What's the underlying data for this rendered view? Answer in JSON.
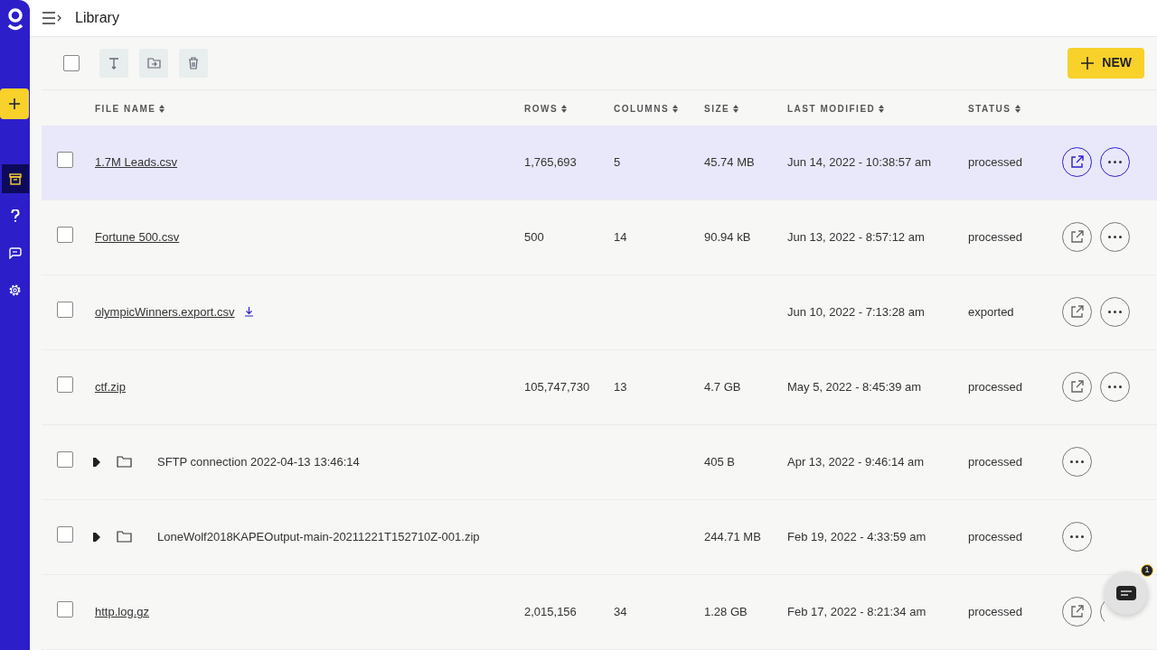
{
  "header": {
    "title": "Library"
  },
  "toolbar": {
    "select_all_checked": false,
    "new_button": "NEW"
  },
  "table": {
    "columns": [
      "FILE NAME",
      "ROWS",
      "COLUMNS",
      "SIZE",
      "LAST MODIFIED",
      "STATUS"
    ],
    "rows": [
      {
        "kind": "file",
        "checked": false,
        "name": "1.7M Leads.csv",
        "rows": "1,765,693",
        "columns": "5",
        "size": "45.74 MB",
        "modified": "Jun 14, 2022 - 10:38:57 am",
        "status": "processed",
        "highlighted": true,
        "downloadable": false
      },
      {
        "kind": "file",
        "checked": false,
        "name": "Fortune 500.csv",
        "rows": "500",
        "columns": "14",
        "size": "90.94 kB",
        "modified": "Jun 13, 2022 - 8:57:12 am",
        "status": "processed",
        "highlighted": false,
        "downloadable": false
      },
      {
        "kind": "file",
        "checked": false,
        "name": "olympicWinners.export.csv",
        "modified": "Jun 10, 2022 - 7:13:28 am",
        "status": "exported",
        "highlighted": false,
        "downloadable": true
      },
      {
        "kind": "file",
        "checked": false,
        "name": "ctf.zip",
        "rows": "105,747,730",
        "columns": "13",
        "size": "4.7 GB",
        "modified": "May 5, 2022 - 8:45:39 am",
        "status": "processed",
        "highlighted": false,
        "downloadable": false
      },
      {
        "kind": "folder",
        "checked": false,
        "name": "SFTP connection 2022-04-13 13:46:14",
        "size": "405 B",
        "modified": "Apr 13, 2022 - 9:46:14 am",
        "status": "processed",
        "highlighted": false
      },
      {
        "kind": "folder",
        "checked": false,
        "name": "LoneWolf2018KAPEOutput-main-20211221T152710Z-001.zip",
        "size": "244.71 MB",
        "modified": "Feb 19, 2022 - 4:33:59 am",
        "status": "processed",
        "highlighted": false
      },
      {
        "kind": "file",
        "checked": false,
        "name": "http.log.gz",
        "rows": "2,015,156",
        "columns": "34",
        "size": "1.28 GB",
        "modified": "Feb 17, 2022 - 8:21:34 am",
        "status": "processed",
        "highlighted": false,
        "downloadable": false
      }
    ]
  },
  "chat": {
    "badge": "1"
  }
}
